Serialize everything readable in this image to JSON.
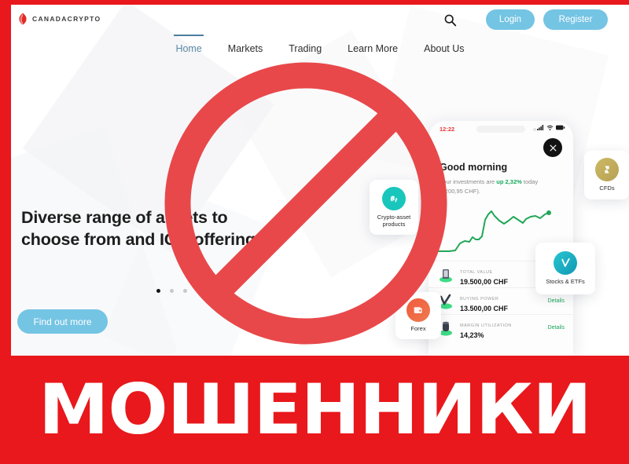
{
  "colors": {
    "banner_red": "#e8181c",
    "accent_blue": "#74c4e4",
    "nav_active": "#5b89a6",
    "green": "#19a55c",
    "ban_red": "#e8484a"
  },
  "site": {
    "logo": {
      "text": "CANADACRYPTO",
      "icon": "maple-leaf-icon"
    },
    "header": {
      "search_icon": "search-icon",
      "login_label": "Login",
      "register_label": "Register"
    },
    "nav": [
      {
        "label": "Home",
        "active": true
      },
      {
        "label": "Markets",
        "active": false
      },
      {
        "label": "Trading",
        "active": false
      },
      {
        "label": "Learn More",
        "active": false
      },
      {
        "label": "About Us",
        "active": false
      }
    ],
    "hero": {
      "headline_line1": "Diverse range of assets to",
      "headline_line2": "choose from and ICO offerings.",
      "cta_label": "Find out more",
      "carousel_dots": 4,
      "carousel_active_index": 0
    },
    "phone": {
      "time": "12:22",
      "greeting": "Good morning",
      "subtitle_prefix": "Your investments are ",
      "subtitle_highlight": "up 2,32%",
      "subtitle_suffix": " today (+200,95 CHF).",
      "close_icon": "close-icon",
      "rows": [
        {
          "label": "TOTAL VALUE",
          "value": "19.500,00 CHF",
          "link": "",
          "icon": "phone-stack-icon"
        },
        {
          "label": "BUYING POWER",
          "value": "13.500,00 CHF",
          "link": "Details",
          "icon": "check-arrow-icon"
        },
        {
          "label": "MARGIN UTILIZATION",
          "value": "14,23%",
          "link": "Details",
          "icon": "coin-stack-icon"
        }
      ]
    },
    "feature_cards": [
      {
        "label": "Crypto-asset products",
        "icon": "bitcoin-icon"
      },
      {
        "label": "Forex",
        "icon": "wallet-icon"
      },
      {
        "label": "CFDs",
        "icon": "cfd-icon"
      },
      {
        "label": "Stocks & ETFs",
        "icon": "chart-arrow-icon"
      }
    ]
  },
  "overlay": {
    "prohibition_icon": "prohibition-sign-icon",
    "banner_text": "МОШЕННИКИ"
  }
}
